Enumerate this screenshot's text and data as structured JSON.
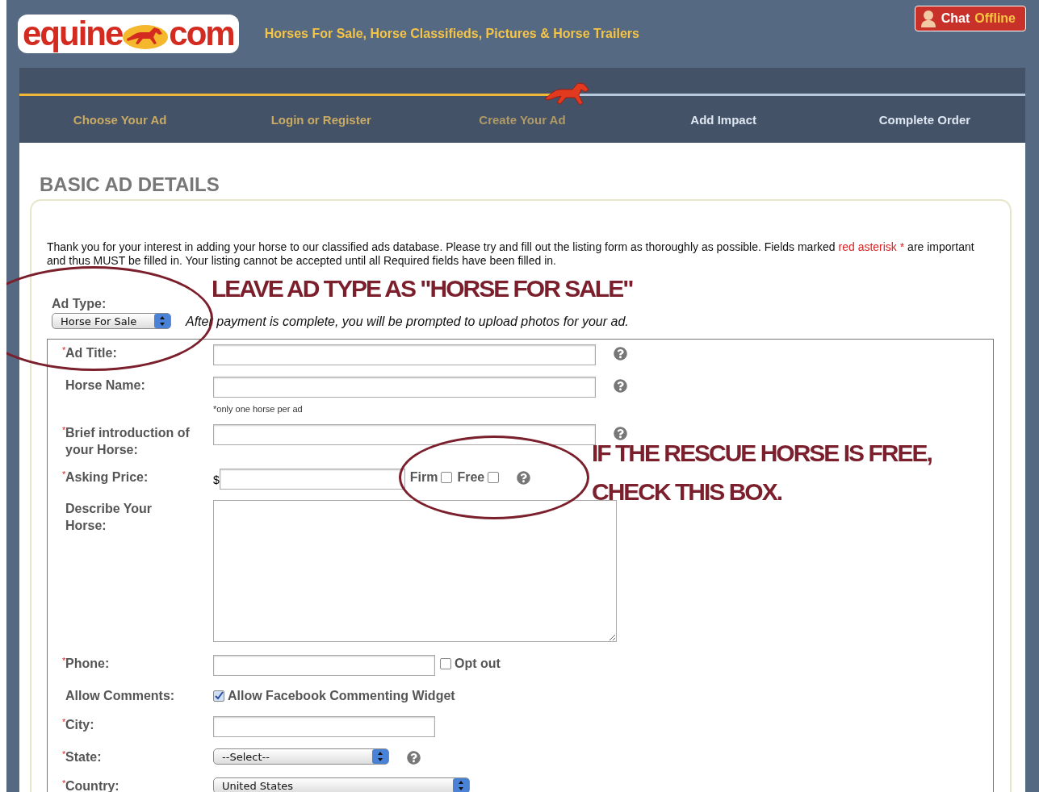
{
  "header": {
    "logo": {
      "left": "equine",
      "right": "com"
    },
    "tagline": "Horses For Sale, Horse Classifieds, Pictures & Horse Trailers",
    "chat_button": {
      "label": "Chat",
      "status": "Offline"
    }
  },
  "steps": {
    "level": 0.545,
    "items": [
      {
        "label": "Choose Your Ad",
        "completed": true,
        "selected": false
      },
      {
        "label": "Login or Register",
        "completed": true,
        "selected": false
      },
      {
        "label": "Create Your Ad",
        "completed": false,
        "selected": true
      },
      {
        "label": "Add Impact",
        "completed": false,
        "selected": false
      },
      {
        "label": "Complete Order",
        "completed": false,
        "selected": false
      }
    ]
  },
  "section_title": "BASIC AD DETAILS",
  "intro": {
    "before": "Thank you for your interest in adding your horse to our classified ads database. Please try and fill out the listing form as thoroughly as possible. Fields marked ",
    "highlight": "red asterisk *",
    "after": " are important and thus MUST be filled in. Your listing cannot be accepted until all Required fields have been filled in."
  },
  "ad_type": {
    "label": "Ad Type:",
    "value": "Horse For Sale",
    "note": "After payment is complete, you will be prompted to upload photos for your ad."
  },
  "form": [
    {
      "kind": "text",
      "marker": "*",
      "label": "Ad Title:",
      "help": true
    },
    {
      "kind": "text",
      "label": "Horse Name:",
      "help": true,
      "note": "*only one horse per ad"
    },
    {
      "kind": "text",
      "marker": "*",
      "label": "Brief introduction of your Horse:",
      "help": true
    },
    {
      "kind": "price",
      "marker": "*",
      "label": "Asking Price:",
      "help": true,
      "currency": "$",
      "options": [
        {
          "label": "Firm",
          "checked": false
        },
        {
          "label": "Free",
          "checked": false
        }
      ]
    },
    {
      "kind": "textarea",
      "label": "Describe Your Horse:",
      "help": false
    },
    {
      "kind": "short",
      "marker": "*",
      "label": "Phone:",
      "help": false,
      "options": [
        {
          "label": "Opt out",
          "checked": false
        }
      ]
    },
    {
      "kind": "checkbox",
      "label": "Allow Comments:",
      "help": false,
      "options": [
        {
          "label": "Allow Facebook Commenting Widget",
          "checked": true
        }
      ]
    },
    {
      "kind": "short",
      "marker": "*",
      "label": "City:",
      "help": false
    },
    {
      "kind": "select",
      "marker": "*",
      "label": "State:",
      "help": true,
      "value": "--Select--"
    },
    {
      "kind": "select",
      "marker": "*",
      "label": "Country:",
      "help": false,
      "value": "United States"
    }
  ],
  "annotations": [
    {
      "text": "LEAVE AD TYPE AS \"HORSE FOR SALE\""
    },
    {
      "text": "IF THE RESCUE HORSE IS FREE, CHECK THIS BOX."
    }
  ]
}
